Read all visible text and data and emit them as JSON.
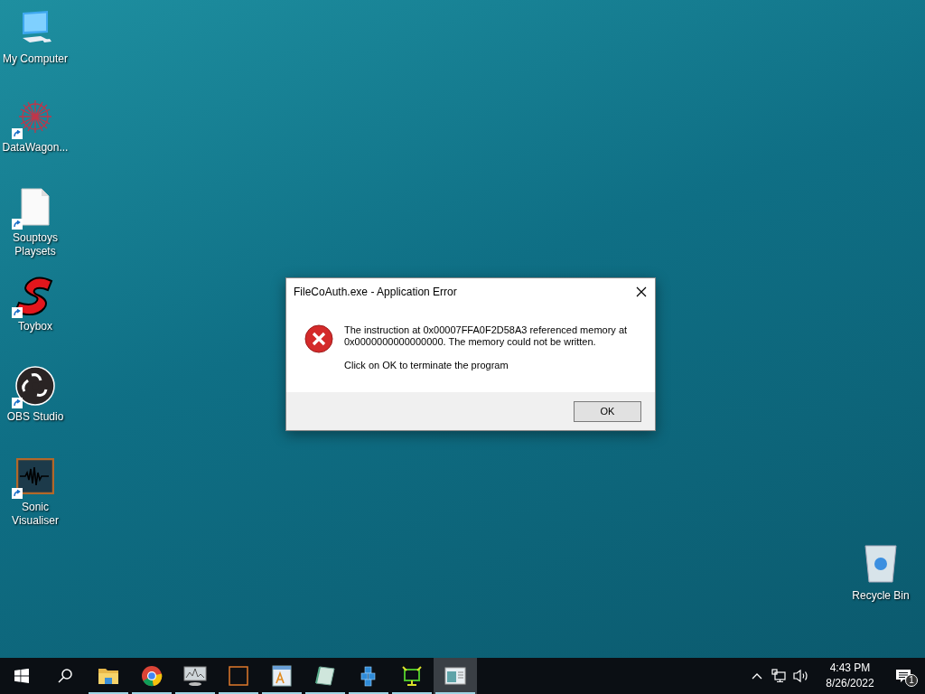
{
  "desktop_icons": [
    {
      "kind": "computer",
      "label": "My Computer",
      "shortcut": false
    },
    {
      "kind": "star",
      "label": "DataWagon...",
      "shortcut": true
    },
    {
      "kind": "file",
      "label": "Souptoys Playsets",
      "shortcut": true
    },
    {
      "kind": "s-logo",
      "label": "Toybox",
      "shortcut": true
    },
    {
      "kind": "obs",
      "label": "OBS Studio",
      "shortcut": true
    },
    {
      "kind": "wave",
      "label": "Sonic Visualiser",
      "shortcut": true
    }
  ],
  "recycle_bin": {
    "label": "Recycle Bin"
  },
  "dialog": {
    "title": "FileCoAuth.exe - Application Error",
    "message": "The instruction at 0x00007FFA0F2D58A3 referenced memory at 0x0000000000000000. The memory could not be written.",
    "prompt": "Click on OK to terminate the program",
    "button": "OK"
  },
  "taskbar": {
    "apps": [
      {
        "kind": "folder",
        "running": true,
        "selected": false
      },
      {
        "kind": "chrome",
        "running": true,
        "selected": false
      },
      {
        "kind": "monitor",
        "running": true,
        "selected": false
      },
      {
        "kind": "square",
        "running": true,
        "selected": false
      },
      {
        "kind": "doc",
        "running": true,
        "selected": false
      },
      {
        "kind": "notepad",
        "running": true,
        "selected": false
      },
      {
        "kind": "cubes",
        "running": true,
        "selected": false
      },
      {
        "kind": "green",
        "running": true,
        "selected": false
      },
      {
        "kind": "window",
        "running": true,
        "selected": true
      }
    ],
    "time": "4:43 PM",
    "date": "8/26/2022",
    "notification_count": "1"
  }
}
